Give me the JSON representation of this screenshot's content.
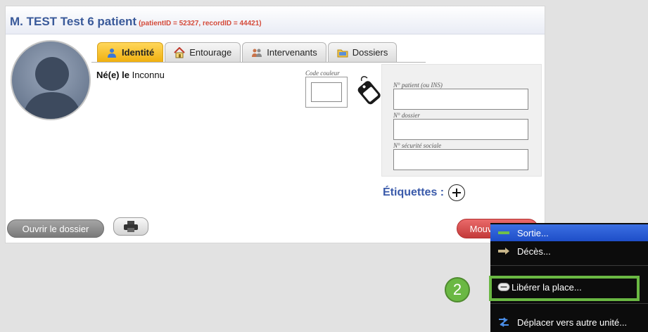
{
  "patient": {
    "name": "M. TEST Test 6 patient",
    "ids": "(patientID = 52327, recordID = 44421)",
    "born_label": "Né(e) le",
    "born_value": "Inconnu"
  },
  "tabs": [
    {
      "label": "Identité",
      "icon": "person-icon",
      "active": true
    },
    {
      "label": "Entourage",
      "icon": "house-icon",
      "active": false
    },
    {
      "label": "Intervenants",
      "icon": "people-icon",
      "active": false
    },
    {
      "label": "Dossiers",
      "icon": "folder-icon",
      "active": false
    }
  ],
  "color_code_label": "Code couleur",
  "id_fields": {
    "patient_label": "N° patient (ou INS)",
    "patient_value": "",
    "dossier_label": "N° dossier",
    "dossier_value": "",
    "secu_label": "N° sécurité sociale",
    "secu_value": ""
  },
  "etiquettes_label": "Étiquettes :",
  "buttons": {
    "open_record": "Ouvrir le dossier",
    "movement": "Mouvement..."
  },
  "context_menu": {
    "items": [
      {
        "label": "Sortie...",
        "icon": "exit-arrow-icon"
      },
      {
        "label": "Décès...",
        "icon": "death-arrow-icon"
      },
      {
        "label": "Libérer la place...",
        "icon": "free-bed-icon"
      },
      {
        "label": "Déplacer vers autre unité...",
        "icon": "transfer-icon"
      }
    ]
  },
  "callout": {
    "number": "2"
  },
  "colors": {
    "title": "#3a5a9a",
    "ids": "#d44a3a",
    "active_tab": "#f0b010",
    "movement_button": "#c33a3a",
    "menu_highlight": "#1e4ec8",
    "callout": "#6ab843"
  }
}
